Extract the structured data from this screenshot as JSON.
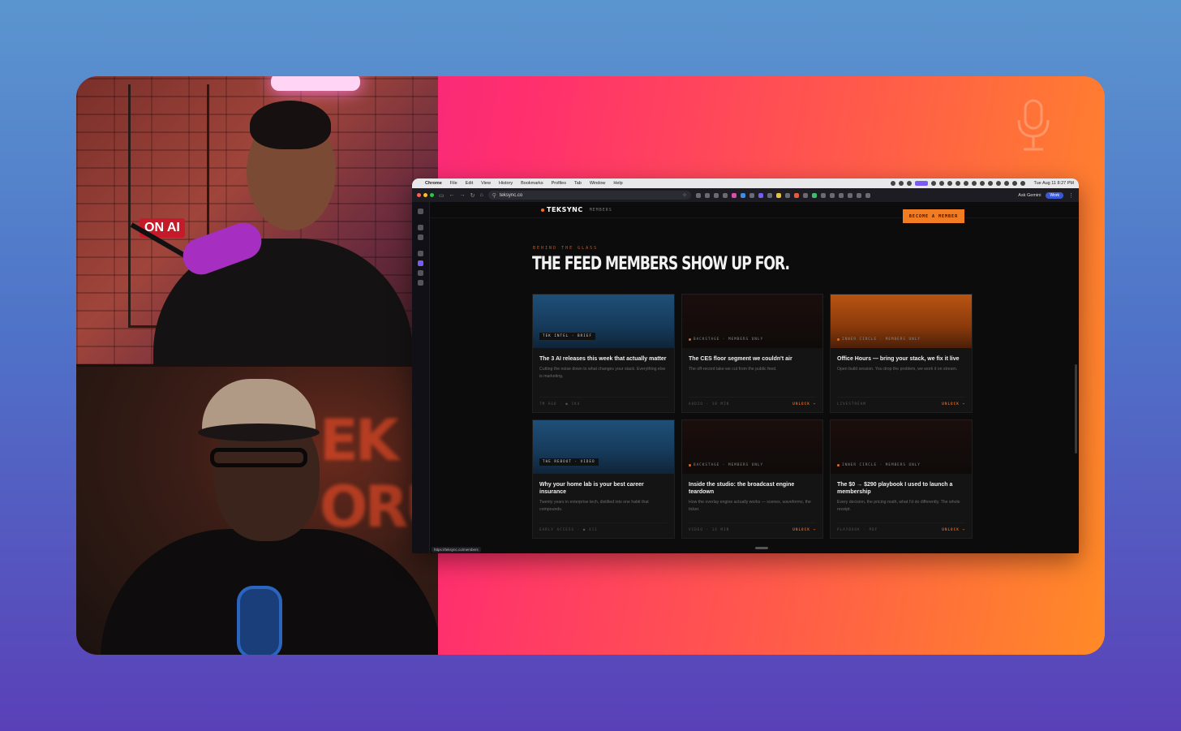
{
  "cams": {
    "top": {
      "sign": "ON AI"
    },
    "bottom": {
      "sign": "EK ORUM"
    }
  },
  "browser": {
    "menubar": {
      "apple": "",
      "app": "Chrome",
      "menus": [
        "File",
        "Edit",
        "View",
        "History",
        "Bookmarks",
        "Profiles",
        "Tab",
        "Window",
        "Help"
      ],
      "clock": "Tue Aug 11  8:27 PM"
    },
    "toolbar": {
      "url": "teksync.co",
      "ask": "Ask Gemini",
      "profile": "Work"
    },
    "status_url": "https://teksync.co/members"
  },
  "site": {
    "logo": "TEKSYNC",
    "nav_members": "MEMBERS",
    "cta": "BECOME A MEMBER",
    "eyebrow": "BEHIND THE GLASS",
    "headline": "THE FEED MEMBERS SHOW UP FOR.",
    "cards": [
      {
        "thumb": "blue",
        "chip": "TEK INTEL · BRIEF",
        "tag": "",
        "title": "The 3 AI releases this week that actually matter",
        "desc": "Cutting the noise down to what changes your stack. Everything else is marketing.",
        "meta": "TM AGO · ● 1K4",
        "unlock": ""
      },
      {
        "thumb": "dark",
        "chip": "",
        "tag": "BACKSTAGE · MEMBERS ONLY",
        "title": "The CES floor segment we couldn't air",
        "desc": "The off-record take we cut from the public feed.",
        "meta": "AUDIO · 18 MIN",
        "unlock": "UNLOCK →"
      },
      {
        "thumb": "orange",
        "chip": "",
        "tag": "INNER CIRCLE · MEMBERS ONLY",
        "title": "Office Hours — bring your stack, we fix it live",
        "desc": "Open build session. You drop the problem, we work it on stream.",
        "meta": "LIVESTREAM",
        "unlock": "UNLOCK →"
      },
      {
        "thumb": "blue",
        "chip": "THE REBOOT · VIDEO",
        "tag": "",
        "title": "Why your home lab is your best career insurance",
        "desc": "Twenty years in enterprise tech, distilled into one habit that compounds.",
        "meta": "EARLY ACCESS · ● 411",
        "unlock": ""
      },
      {
        "thumb": "dark",
        "chip": "",
        "tag": "BACKSTAGE · MEMBERS ONLY",
        "title": "Inside the studio: the broadcast engine teardown",
        "desc": "How the overlay engine actually works — scenes, waveforms, the ticker.",
        "meta": "VIDEO · 14 MIN",
        "unlock": "UNLOCK →"
      },
      {
        "thumb": "dark",
        "chip": "",
        "tag": "INNER CIRCLE · MEMBERS ONLY",
        "title": "The $0 → $290 playbook I used to launch a membership",
        "desc": "Every decision, the pricing math, what I'd do differently. The whole receipt.",
        "meta": "PLAYBOOK · PDF",
        "unlock": "UNLOCK →"
      }
    ]
  }
}
